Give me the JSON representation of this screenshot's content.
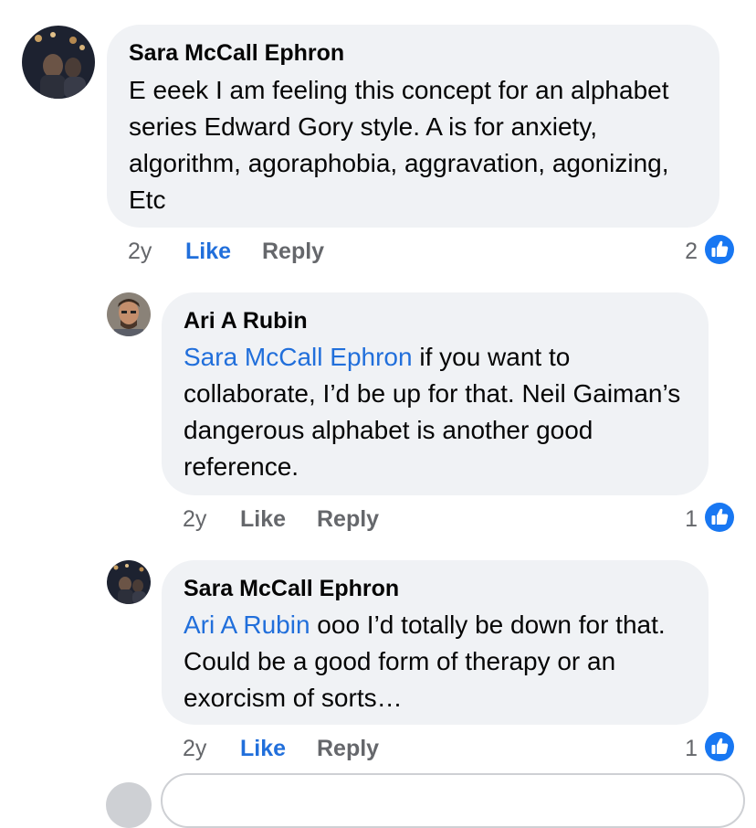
{
  "comments": [
    {
      "author": "Sara McCall Ephron",
      "mention": "",
      "text": "E eeek I am feeling this concept for an alphabet series Edward Gory style. A is for anxiety, algorithm, agoraphobia,  aggravation, agonizing, Etc",
      "time": "2y",
      "like_label": "Like",
      "reply_label": "Reply",
      "reaction_count": "2",
      "liked_by_viewer": true
    },
    {
      "author": "Ari A Rubin",
      "mention": "Sara McCall Ephron",
      "text": " if you want to collaborate, I’d be up for that. Neil Gaiman’s dangerous alphabet is another good reference.",
      "time": "2y",
      "like_label": "Like",
      "reply_label": "Reply",
      "reaction_count": "1",
      "liked_by_viewer": false
    },
    {
      "author": "Sara McCall Ephron",
      "mention": "Ari A Rubin",
      "text": " ooo I’d totally be down for that. Could be a good form of therapy or an exorcism of sorts…",
      "time": "2y",
      "like_label": "Like",
      "reply_label": "Reply",
      "reaction_count": "1",
      "liked_by_viewer": true
    }
  ],
  "colors": {
    "accent": "#216fdb",
    "bubble": "#f0f2f5",
    "meta": "#65676b",
    "like_badge": "#1877f2"
  },
  "icons": {
    "reaction": "thumbs-up-icon"
  }
}
